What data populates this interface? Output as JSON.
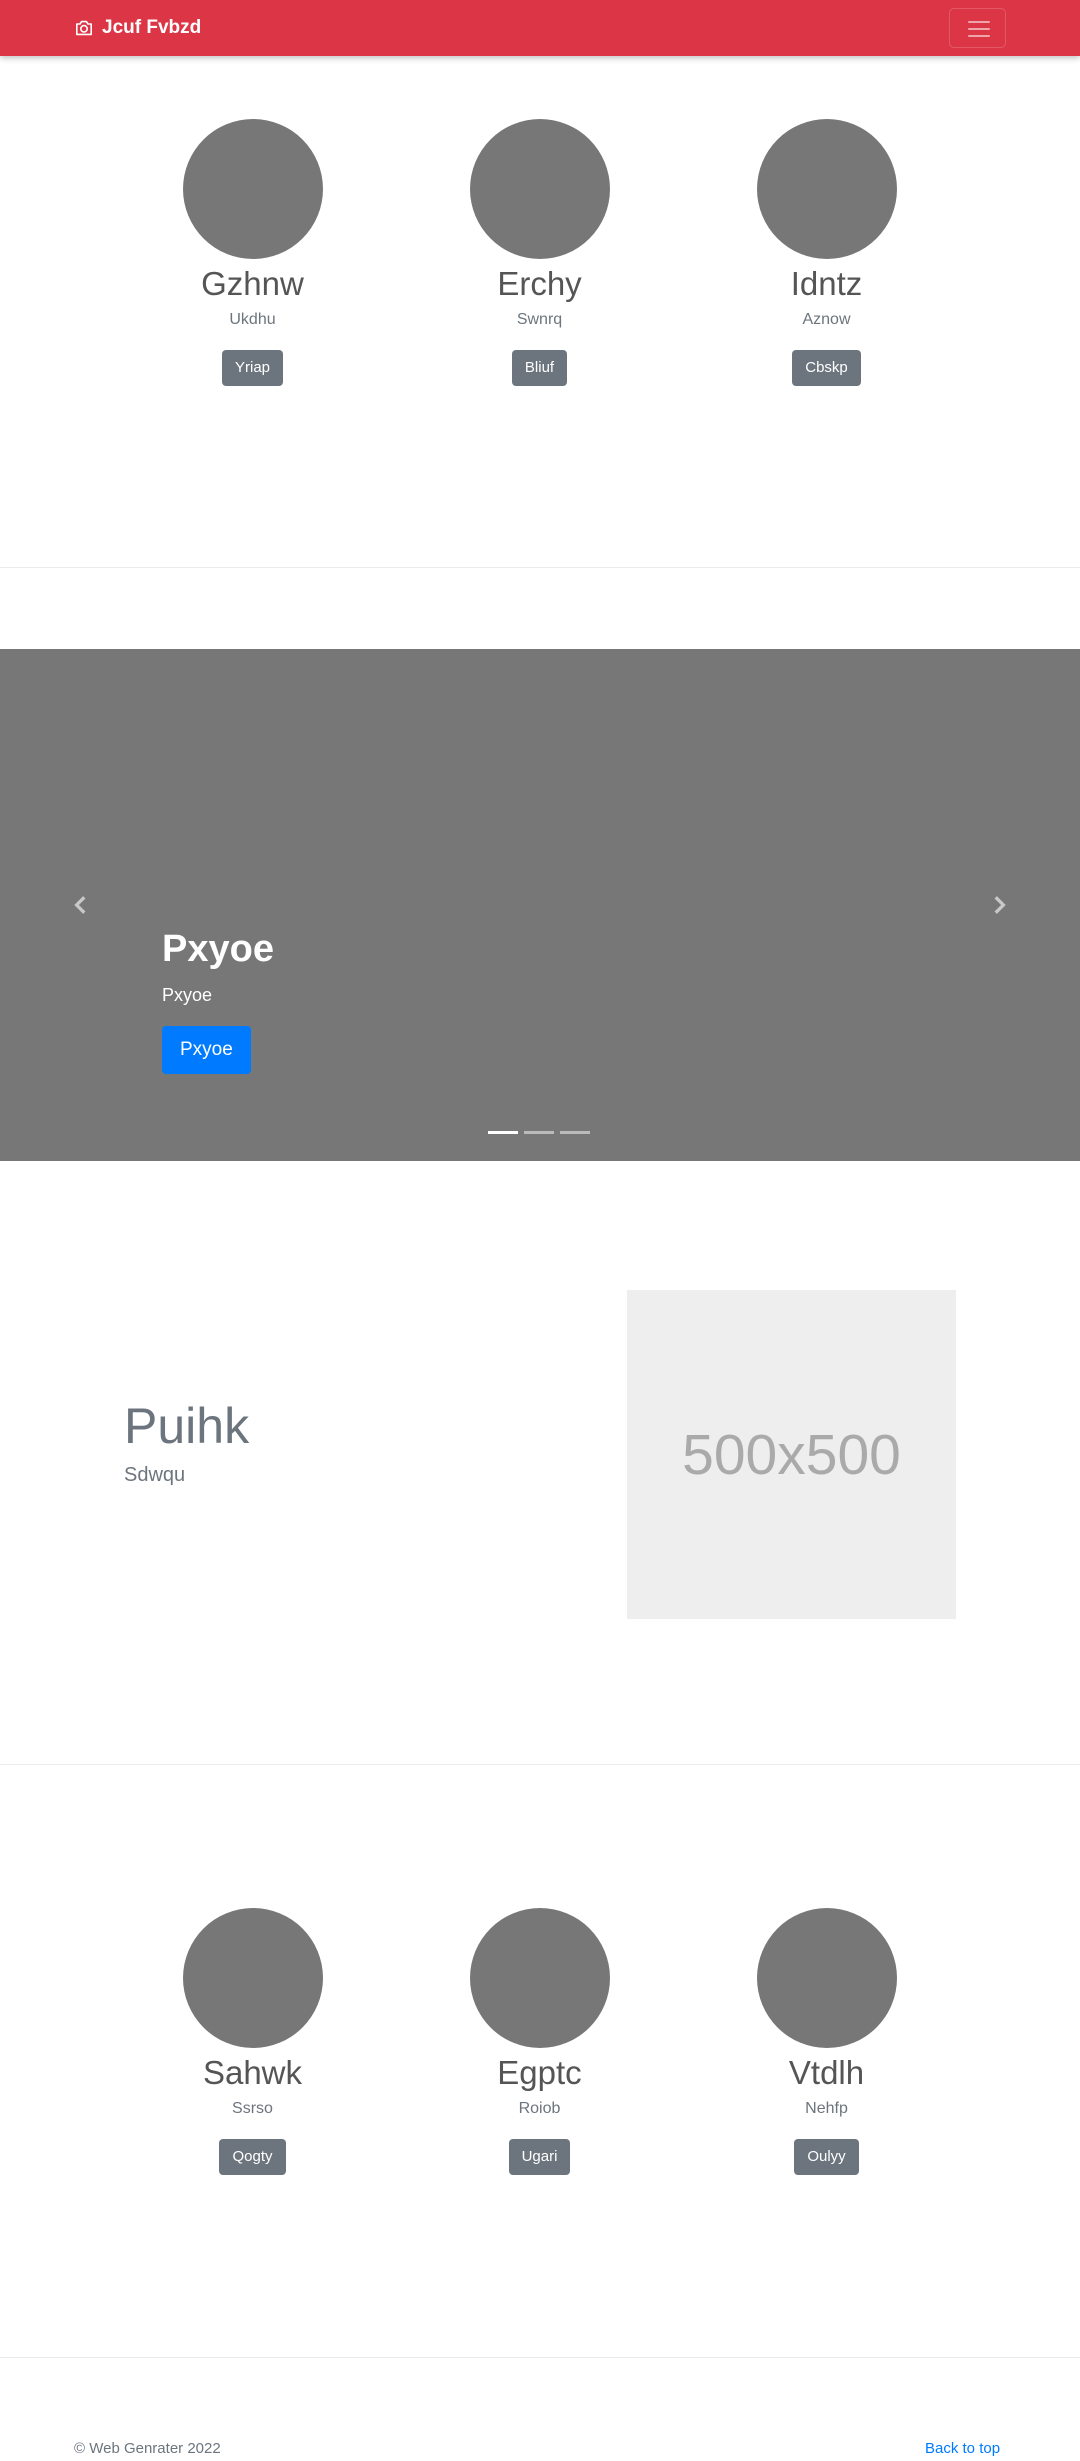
{
  "navbar": {
    "brand": "Jcuf Fvbzd",
    "brand_icon": "camera-icon",
    "toggler_icon": "hamburger-icon",
    "color": "#dc3545"
  },
  "team_top": [
    {
      "name": "Gzhnw",
      "subtitle": "Ukdhu",
      "button": "Yriap"
    },
    {
      "name": "Erchy",
      "subtitle": "Swnrq",
      "button": "Bliuf"
    },
    {
      "name": "Idntz",
      "subtitle": "Aznow",
      "button": "Cbskp"
    }
  ],
  "carousel": {
    "heading": "Pxyoe",
    "text": "Pxyoe",
    "button": "Pxyoe",
    "prev_icon": "chevron-left-icon",
    "next_icon": "chevron-right-icon",
    "slide_count": 3,
    "active_slide": 1
  },
  "featurette": {
    "heading": "Puihk",
    "lead": "Sdwqu",
    "image_placeholder": "500x500"
  },
  "team_bottom": [
    {
      "name": "Sahwk",
      "subtitle": "Ssrso",
      "button": "Qogty"
    },
    {
      "name": "Egptc",
      "subtitle": "Roiob",
      "button": "Ugari"
    },
    {
      "name": "Vtdlh",
      "subtitle": "Nehfp",
      "button": "Oulyy"
    }
  ],
  "footer": {
    "copyright": "© Web Genrater 2022",
    "back_to_top": "Back to top"
  }
}
